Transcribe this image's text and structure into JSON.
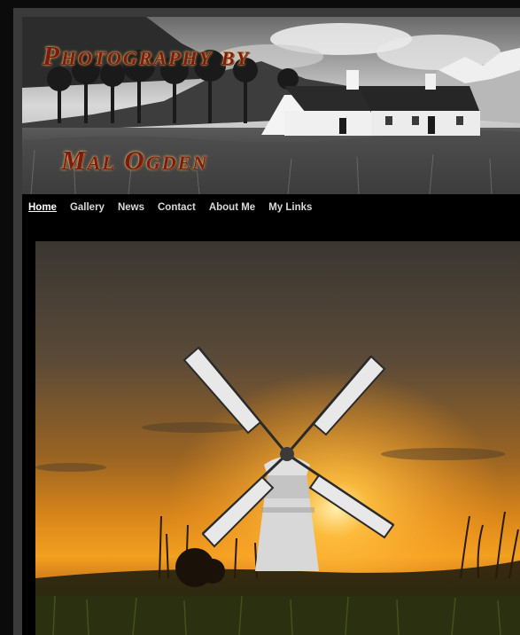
{
  "banner": {
    "title_line1": "Photography by",
    "title_line2": "Mal Ogden"
  },
  "nav": {
    "items": [
      {
        "label": "Home",
        "active": true
      },
      {
        "label": "Gallery",
        "active": false
      },
      {
        "label": "News",
        "active": false
      },
      {
        "label": "Contact",
        "active": false
      },
      {
        "label": "About Me",
        "active": false
      },
      {
        "label": "My Links",
        "active": false
      }
    ]
  },
  "colors": {
    "page_background": "#0b0b0b",
    "frame": "#3a3a3a",
    "content_background": "#000000",
    "nav_text": "#d9d9d9",
    "title_text": "#7a1c10",
    "title_glow": "#ffd070"
  },
  "images": {
    "banner": "black-and-white-cottage-landscape",
    "feature": "windmill-sunset-photo"
  }
}
